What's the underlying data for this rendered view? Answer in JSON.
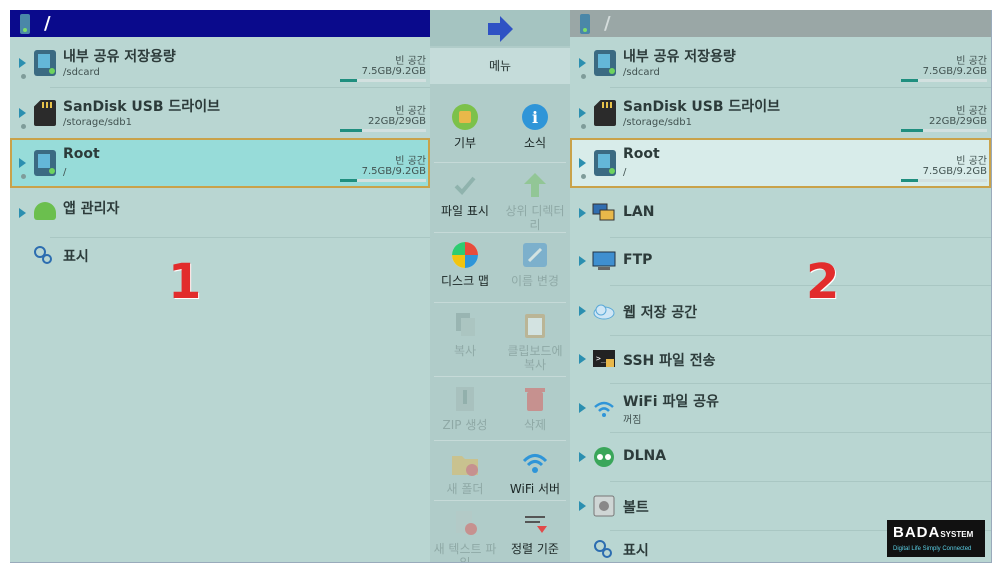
{
  "left_pane": {
    "path": "/",
    "storage": [
      {
        "name": "내부 공유 저장용량",
        "path": "/sdcard",
        "free_label": "빈 공간",
        "free": "7.5GB/9.2GB",
        "used_fraction": 0.2
      },
      {
        "name": "SanDisk USB 드라이브",
        "path": "/storage/sdb1",
        "free_label": "빈 공간",
        "free": "22GB/29GB",
        "used_fraction": 0.25
      },
      {
        "name": "Root",
        "path": "/",
        "free_label": "빈 공간",
        "free": "7.5GB/9.2GB",
        "used_fraction": 0.2
      }
    ],
    "app_manager": "앱 관리자",
    "display": "표시",
    "annotation": "1"
  },
  "menu": {
    "title": "메뉴",
    "items": [
      {
        "label": "기부",
        "enabled": true,
        "icon": "donate-icon"
      },
      {
        "label": "소식",
        "enabled": true,
        "icon": "info-icon"
      },
      {
        "label": "파일 표시",
        "enabled": true,
        "icon": "check-icon"
      },
      {
        "label": "상위 디렉터리",
        "enabled": false,
        "icon": "up-arrow-icon"
      },
      {
        "label": "디스크 맵",
        "enabled": true,
        "icon": "disk-map-icon"
      },
      {
        "label": "이름 변경",
        "enabled": false,
        "icon": "rename-icon"
      },
      {
        "label": "복사",
        "enabled": false,
        "icon": "copy-icon"
      },
      {
        "label": "클립보드에 복사",
        "enabled": false,
        "icon": "clipboard-icon"
      },
      {
        "label": "ZIP 생성",
        "enabled": false,
        "icon": "zip-icon"
      },
      {
        "label": "삭제",
        "enabled": false,
        "icon": "trash-icon"
      },
      {
        "label": "새 폴더",
        "enabled": false,
        "icon": "new-folder-icon"
      },
      {
        "label": "WiFi 서버",
        "enabled": true,
        "icon": "wifi-icon"
      },
      {
        "label": "새 텍스트 파일",
        "enabled": false,
        "icon": "new-text-file-icon"
      },
      {
        "label": "정렬 기준",
        "enabled": true,
        "icon": "sort-icon"
      }
    ]
  },
  "right_pane": {
    "path": "/",
    "storage": [
      {
        "name": "내부 공유 저장용량",
        "path": "/sdcard",
        "free_label": "빈 공간",
        "free": "7.5GB/9.2GB",
        "used_fraction": 0.2
      },
      {
        "name": "SanDisk USB 드라이브",
        "path": "/storage/sdb1",
        "free_label": "빈 공간",
        "free": "22GB/29GB",
        "used_fraction": 0.25
      },
      {
        "name": "Root",
        "path": "/",
        "free_label": "빈 공간",
        "free": "7.5GB/9.2GB",
        "used_fraction": 0.2
      }
    ],
    "network": [
      {
        "label": "LAN",
        "icon": "lan-icon"
      },
      {
        "label": "FTP",
        "icon": "ftp-icon"
      },
      {
        "label": "웹 저장 공간",
        "icon": "cloud-icon"
      },
      {
        "label": "SSH 파일 전송",
        "icon": "ssh-icon"
      },
      {
        "label": "WiFi 파일 공유",
        "sub": "꺼짐",
        "icon": "wifi-icon"
      },
      {
        "label": "DLNA",
        "icon": "dlna-icon"
      },
      {
        "label": "볼트",
        "icon": "vault-icon"
      }
    ],
    "display": "표시",
    "annotation": "2"
  },
  "logo": {
    "brand": "BADA",
    "brand_small": "SYSTEM",
    "tagline": "Digital Life Simply Connected"
  },
  "colors": {
    "left_titlebar": "#0a0a8c",
    "selection_border": "#c9a24a",
    "annotation": "#e22c2c"
  }
}
